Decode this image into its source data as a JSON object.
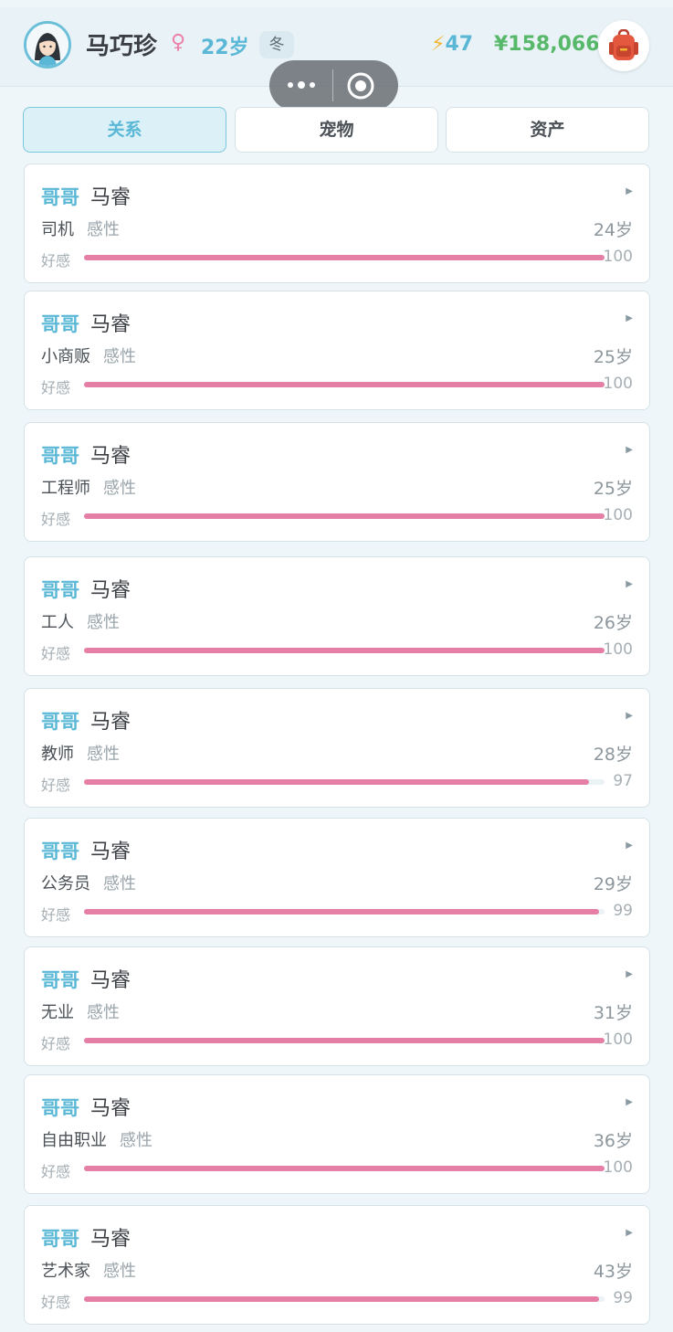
{
  "profile": {
    "name": "马巧珍",
    "gender_symbol": "♀",
    "age": "22岁",
    "season": "冬",
    "energy": "47",
    "money": "¥158,066"
  },
  "tabs": [
    {
      "label": "关系",
      "active": true
    },
    {
      "label": "宠物",
      "active": false
    },
    {
      "label": "资产",
      "active": false
    }
  ],
  "relations": [
    {
      "relation": "哥哥",
      "name": "马睿",
      "job": "司机",
      "trait": "感性",
      "age": "24岁",
      "fav_label": "好感",
      "favor": 100
    },
    {
      "relation": "哥哥",
      "name": "马睿",
      "job": "小商贩",
      "trait": "感性",
      "age": "25岁",
      "fav_label": "好感",
      "favor": 100
    },
    {
      "relation": "哥哥",
      "name": "马睿",
      "job": "工程师",
      "trait": "感性",
      "age": "25岁",
      "fav_label": "好感",
      "favor": 100
    },
    {
      "relation": "哥哥",
      "name": "马睿",
      "job": "工人",
      "trait": "感性",
      "age": "26岁",
      "fav_label": "好感",
      "favor": 100
    },
    {
      "relation": "哥哥",
      "name": "马睿",
      "job": "教师",
      "trait": "感性",
      "age": "28岁",
      "fav_label": "好感",
      "favor": 97
    },
    {
      "relation": "哥哥",
      "name": "马睿",
      "job": "公务员",
      "trait": "感性",
      "age": "29岁",
      "fav_label": "好感",
      "favor": 99
    },
    {
      "relation": "哥哥",
      "name": "马睿",
      "job": "无业",
      "trait": "感性",
      "age": "31岁",
      "fav_label": "好感",
      "favor": 100
    },
    {
      "relation": "哥哥",
      "name": "马睿",
      "job": "自由职业",
      "trait": "感性",
      "age": "36岁",
      "fav_label": "好感",
      "favor": 100
    },
    {
      "relation": "哥哥",
      "name": "马睿",
      "job": "艺术家",
      "trait": "感性",
      "age": "43岁",
      "fav_label": "好感",
      "favor": 99
    }
  ],
  "icons": {
    "avatar": "female-avatar-icon",
    "energy": "lightning-icon",
    "bag": "backpack-icon",
    "more": "more-dots-icon",
    "close": "capsule-target-icon",
    "arrow": "triangle-right-icon"
  },
  "colors": {
    "accent": "#5ab8d6",
    "favor_bar": "#e57fa5",
    "money": "#58b86a",
    "gender": "#ec7fa5"
  }
}
